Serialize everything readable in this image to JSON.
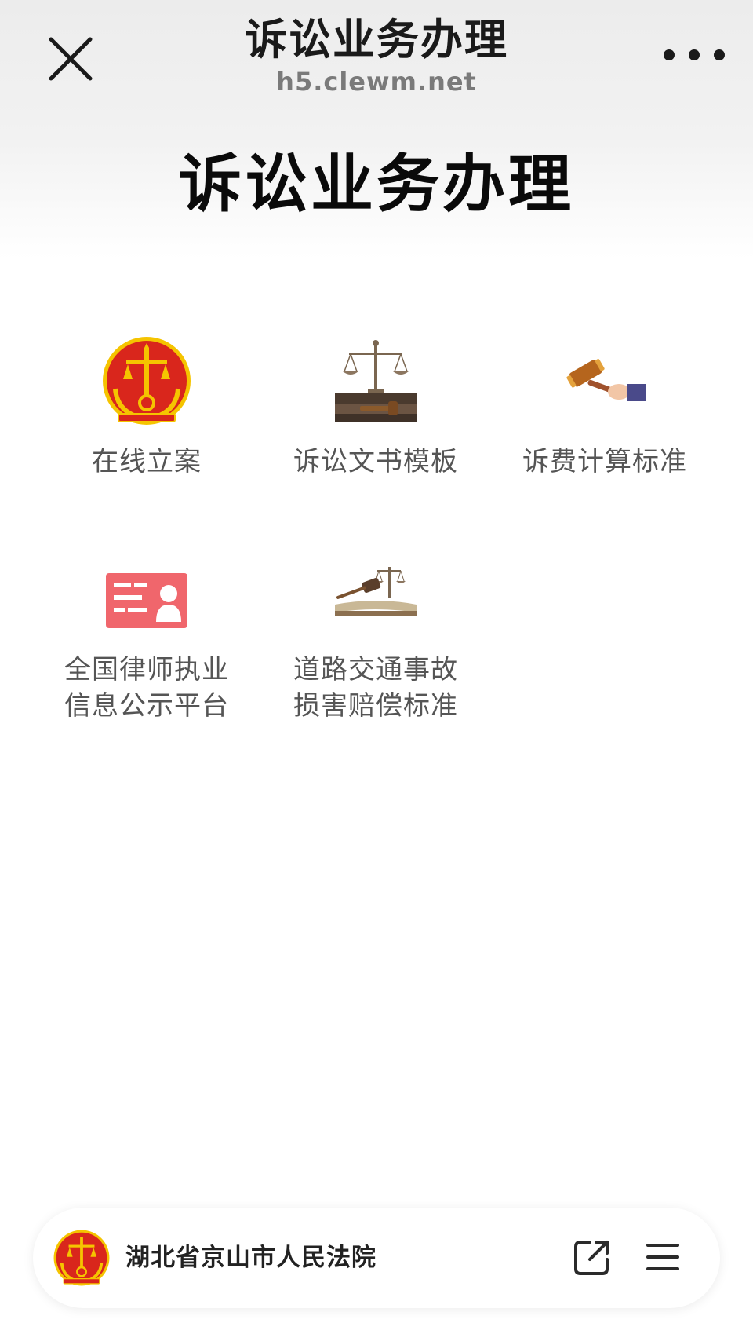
{
  "navbar": {
    "title": "诉讼业务办理",
    "url": "h5.clewm.net",
    "close_icon": "close-icon",
    "more_icon": "more-dots-icon"
  },
  "page": {
    "heading": "诉讼业务办理"
  },
  "services": [
    {
      "icon": "court-emblem-icon",
      "label_line1": "在线立案",
      "label_line2": ""
    },
    {
      "icon": "scales-books-icon",
      "label_line1": "诉讼文书模板",
      "label_line2": ""
    },
    {
      "icon": "gavel-hand-icon",
      "label_line1": "诉费计算标准",
      "label_line2": ""
    },
    {
      "icon": "id-card-icon",
      "label_line1": "全国律师执业",
      "label_line2": "信息公示平台"
    },
    {
      "icon": "gavel-book-scales-icon",
      "label_line1": "道路交通事故",
      "label_line2": "损害赔偿标准"
    }
  ],
  "bottom_bar": {
    "court_name": "湖北省京山市人民法院",
    "logo_icon": "court-emblem-icon",
    "share_icon": "open-external-icon",
    "menu_icon": "hamburger-menu-icon"
  },
  "colors": {
    "emblem_red": "#d9261c",
    "emblem_gold": "#f5c400",
    "card_pink": "#f0666c",
    "label_gray": "#555555",
    "wood_brown": "#8b5a2b"
  }
}
